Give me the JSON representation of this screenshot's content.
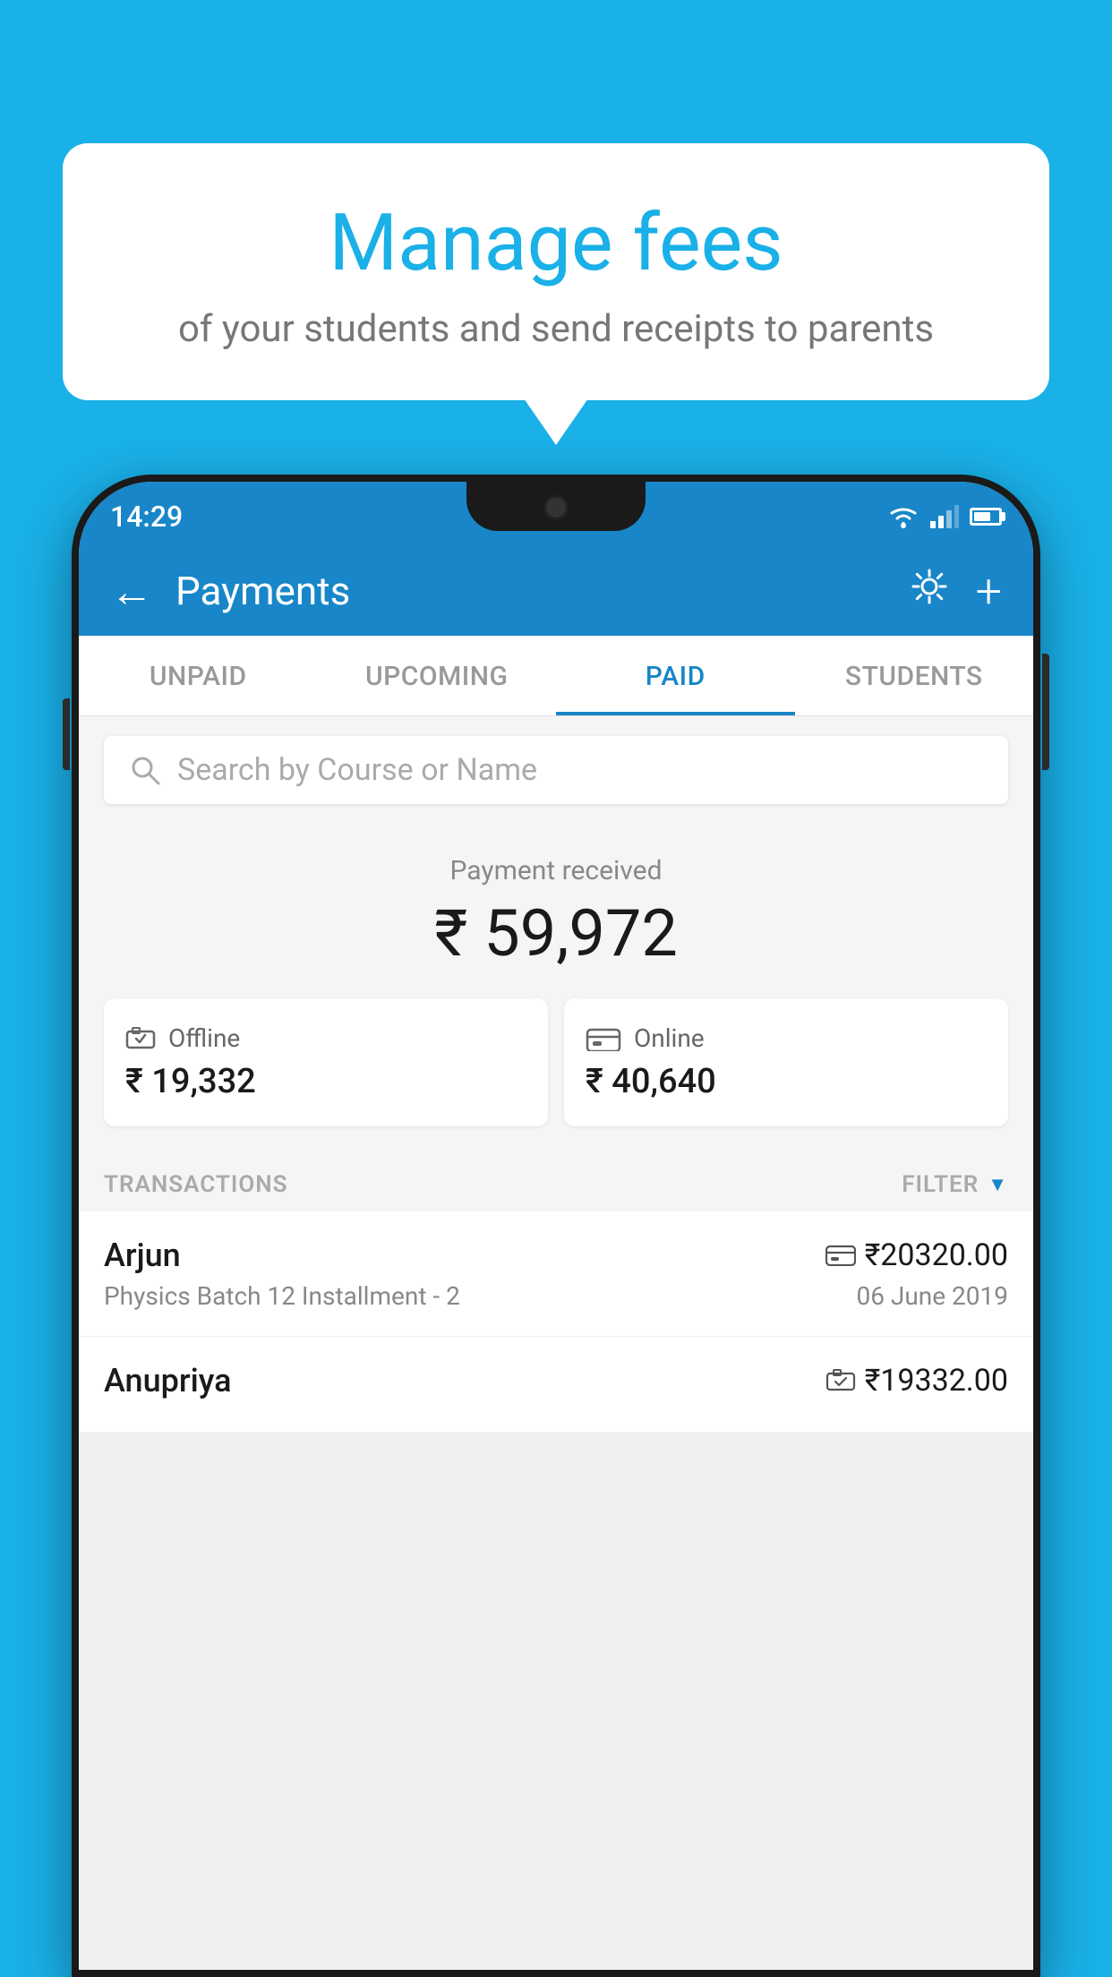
{
  "background_color": "#1ab0e8",
  "speech_bubble": {
    "title": "Manage fees",
    "subtitle": "of your students and send receipts to parents"
  },
  "status_bar": {
    "time": "14:29"
  },
  "header": {
    "title": "Payments",
    "back_label": "←",
    "gear_label": "⚙",
    "plus_label": "+"
  },
  "tabs": [
    {
      "label": "UNPAID",
      "active": false
    },
    {
      "label": "UPCOMING",
      "active": false
    },
    {
      "label": "PAID",
      "active": true
    },
    {
      "label": "STUDENTS",
      "active": false
    }
  ],
  "search": {
    "placeholder": "Search by Course or Name"
  },
  "payment_received": {
    "label": "Payment received",
    "amount": "₹ 59,972"
  },
  "payment_cards": [
    {
      "type": "Offline",
      "amount": "₹ 19,332",
      "icon": "offline"
    },
    {
      "type": "Online",
      "amount": "₹ 40,640",
      "icon": "online"
    }
  ],
  "transactions_header": {
    "label": "TRANSACTIONS",
    "filter_label": "FILTER"
  },
  "transactions": [
    {
      "name": "Arjun",
      "course": "Physics Batch 12 Installment - 2",
      "amount": "₹20320.00",
      "date": "06 June 2019",
      "payment_type": "online"
    },
    {
      "name": "Anupriya",
      "course": "",
      "amount": "₹19332.00",
      "date": "",
      "payment_type": "offline"
    }
  ]
}
